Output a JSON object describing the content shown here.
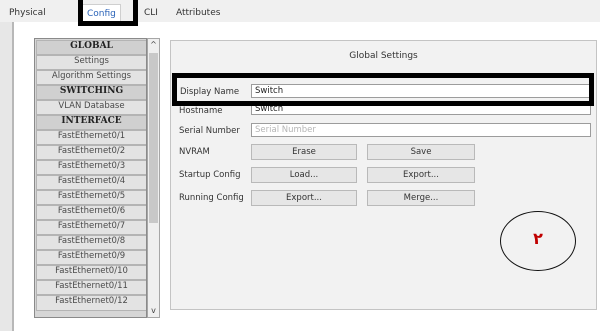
{
  "tabs": [
    {
      "label": "Physical"
    },
    {
      "label": "Config"
    },
    {
      "label": "CLI"
    },
    {
      "label": "Attributes"
    }
  ],
  "sidebar": {
    "items": [
      {
        "label": "GLOBAL",
        "header": true
      },
      {
        "label": "Settings",
        "header": false
      },
      {
        "label": "Algorithm Settings",
        "header": false
      },
      {
        "label": "SWITCHING",
        "header": true
      },
      {
        "label": "VLAN Database",
        "header": false
      },
      {
        "label": "INTERFACE",
        "header": true
      },
      {
        "label": "FastEthernet0/1",
        "header": false
      },
      {
        "label": "FastEthernet0/2",
        "header": false
      },
      {
        "label": "FastEthernet0/3",
        "header": false
      },
      {
        "label": "FastEthernet0/4",
        "header": false
      },
      {
        "label": "FastEthernet0/5",
        "header": false
      },
      {
        "label": "FastEthernet0/6",
        "header": false
      },
      {
        "label": "FastEthernet0/7",
        "header": false
      },
      {
        "label": "FastEthernet0/8",
        "header": false
      },
      {
        "label": "FastEthernet0/9",
        "header": false
      },
      {
        "label": "FastEthernet0/10",
        "header": false
      },
      {
        "label": "FastEthernet0/11",
        "header": false
      },
      {
        "label": "FastEthernet0/12",
        "header": false
      }
    ],
    "scroll_up": "^",
    "scroll_down": "v"
  },
  "panel": {
    "title": "Global Settings",
    "display_name": {
      "label": "Display Name",
      "value": "Switch"
    },
    "hostname": {
      "label": "Hostname",
      "value": "Switch"
    },
    "serial": {
      "label": "Serial Number",
      "placeholder": "Serial Number"
    },
    "nvram": {
      "label": "NVRAM",
      "erase": "Erase",
      "save": "Save"
    },
    "startup": {
      "label": "Startup Config",
      "load": "Load...",
      "export": "Export..."
    },
    "running": {
      "label": "Running Config",
      "export": "Export...",
      "merge": "Merge..."
    }
  },
  "annotation": {
    "number": "٢"
  }
}
